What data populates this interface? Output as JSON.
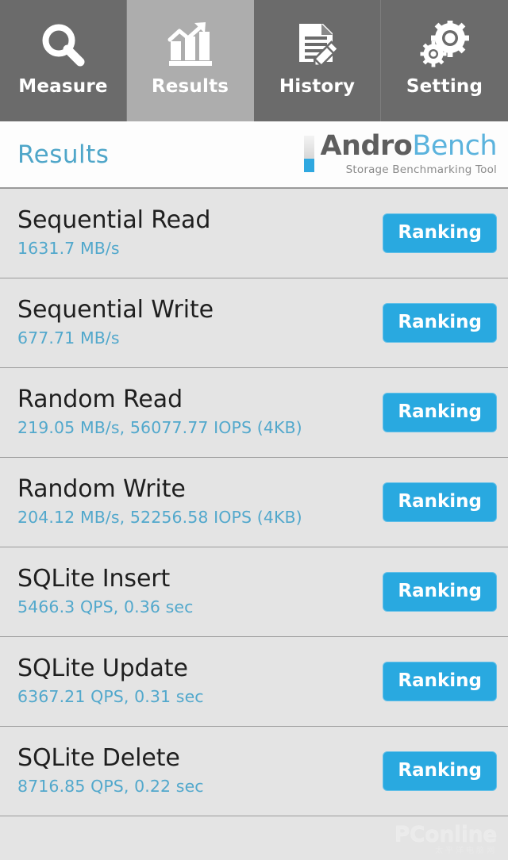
{
  "tabs": [
    {
      "label": "Measure",
      "icon": "magnifier-icon",
      "active": false
    },
    {
      "label": "Results",
      "icon": "bar-chart-arrow-icon",
      "active": true
    },
    {
      "label": "History",
      "icon": "document-pencil-icon",
      "active": false
    },
    {
      "label": "Setting",
      "icon": "gears-icon",
      "active": false
    }
  ],
  "header": {
    "title": "Results",
    "logo_primary": "Andro",
    "logo_secondary": "Bench",
    "logo_tagline": "Storage Benchmarking Tool"
  },
  "results": [
    {
      "title": "Sequential Read",
      "value": "1631.7 MB/s",
      "button": "Ranking"
    },
    {
      "title": "Sequential Write",
      "value": "677.71 MB/s",
      "button": "Ranking"
    },
    {
      "title": "Random Read",
      "value": "219.05 MB/s, 56077.77 IOPS (4KB)",
      "button": "Ranking"
    },
    {
      "title": "Random Write",
      "value": "204.12 MB/s, 52256.58 IOPS (4KB)",
      "button": "Ranking"
    },
    {
      "title": "SQLite Insert",
      "value": "5466.3 QPS, 0.36 sec",
      "button": "Ranking"
    },
    {
      "title": "SQLite Update",
      "value": "6367.21 QPS, 0.31 sec",
      "button": "Ranking"
    },
    {
      "title": "SQLite Delete",
      "value": "8716.85 QPS, 0.22 sec",
      "button": "Ranking"
    }
  ],
  "watermark": {
    "main": "PConline",
    "sub": "太平洋电脑网"
  },
  "colors": {
    "tab_bar": "#6b6b6b",
    "tab_active": "#adadad",
    "accent_blue": "#29a9e0",
    "value_blue": "#52a8cc",
    "title_blue": "#4fa6c9",
    "list_bg": "#e4e4e4"
  }
}
